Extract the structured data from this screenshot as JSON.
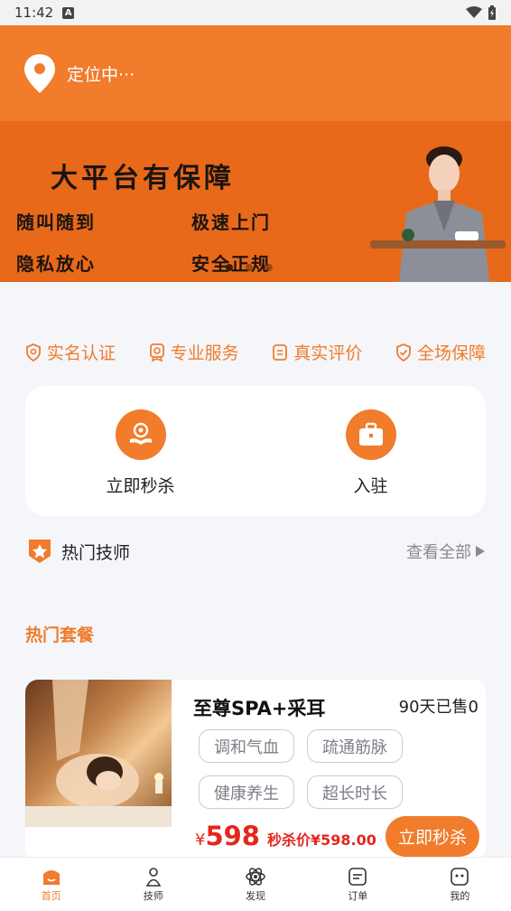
{
  "status_bar": {
    "time": "11:42",
    "badge": "A"
  },
  "header": {
    "location_text": "定位中···"
  },
  "banner": {
    "title": "大平台有保障",
    "lines": [
      "随叫随到",
      "极速上门",
      "隐私放心",
      "安全正规"
    ]
  },
  "features": [
    {
      "label": "实名认证",
      "icon": "id-shield-icon"
    },
    {
      "label": "专业服务",
      "icon": "badge-icon"
    },
    {
      "label": "真实评价",
      "icon": "review-icon"
    },
    {
      "label": "全场保障",
      "icon": "check-shield-icon"
    }
  ],
  "quick_actions": [
    {
      "label": "立即秒杀",
      "icon": "flash-sale-icon"
    },
    {
      "label": "入驻",
      "icon": "briefcase-icon"
    }
  ],
  "hot_technicians": {
    "title": "热门技师",
    "see_all": "查看全部"
  },
  "packages": {
    "title": "热门套餐",
    "items": [
      {
        "name": "至尊SPA+采耳",
        "sold": "90天已售0",
        "tags": [
          "调和气血",
          "疏通筋脉",
          "健康养生",
          "超长时长"
        ],
        "price_symbol": "¥",
        "price": "598",
        "flash_label": "秒杀价",
        "flash_price": "¥598.00",
        "button": "立即秒杀"
      }
    ]
  },
  "tabbar": [
    {
      "label": "首页",
      "active": true
    },
    {
      "label": "技师",
      "active": false
    },
    {
      "label": "发现",
      "active": false
    },
    {
      "label": "订单",
      "active": false
    },
    {
      "label": "我的",
      "active": false
    }
  ],
  "colors": {
    "brand": "#f07c2c",
    "price": "#e5261d",
    "banner": "#e8691a"
  }
}
